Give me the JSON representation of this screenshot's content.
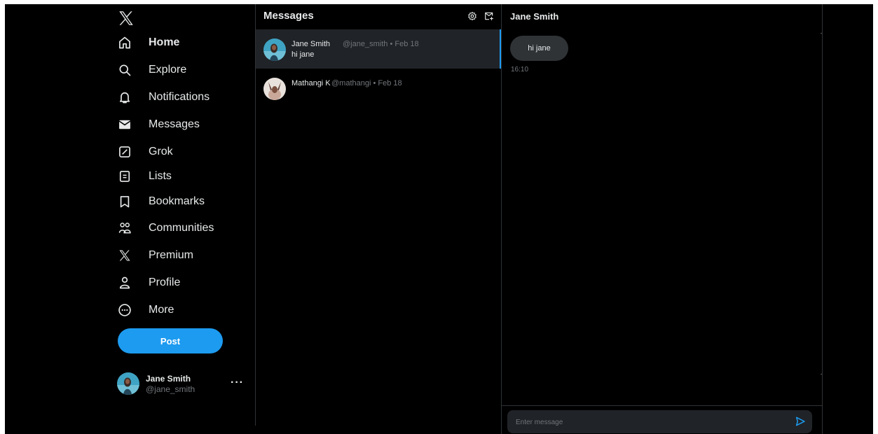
{
  "nav": {
    "items": [
      {
        "label": "Home",
        "icon": "home-icon",
        "active": true
      },
      {
        "label": "Explore",
        "icon": "search-icon"
      },
      {
        "label": "Notifications",
        "icon": "bell-icon"
      },
      {
        "label": "Messages",
        "icon": "envelope-icon"
      },
      {
        "label": "Grok",
        "icon": "grok-icon"
      },
      {
        "label": "Lists",
        "icon": "list-icon"
      },
      {
        "label": "Bookmarks",
        "icon": "bookmark-icon"
      },
      {
        "label": "Communities",
        "icon": "communities-icon"
      },
      {
        "label": "Premium",
        "icon": "x-logo-icon"
      },
      {
        "label": "Profile",
        "icon": "person-icon"
      },
      {
        "label": "More",
        "icon": "more-circle-icon"
      }
    ],
    "post_label": "Post",
    "account": {
      "name": "Jane Smith",
      "handle": "@jane_smith",
      "more": "···"
    }
  },
  "messages": {
    "title": "Messages",
    "conversations": [
      {
        "name": "Jane Smith",
        "handle": "@jane_smith",
        "date": "Feb 18",
        "preview": "hi jane",
        "selected": true
      },
      {
        "name": "Mathangi K",
        "handle": "@mathangi",
        "date": "Feb 18",
        "preview": ""
      }
    ]
  },
  "chat": {
    "title": "Jane Smith",
    "messages": [
      {
        "text": "hi jane",
        "time": "16:10"
      }
    ],
    "composer_placeholder": "Enter message"
  },
  "colors": {
    "accent": "#1d9bf0",
    "background": "#000000",
    "bubble": "#2f3336",
    "muted": "#71767b"
  }
}
